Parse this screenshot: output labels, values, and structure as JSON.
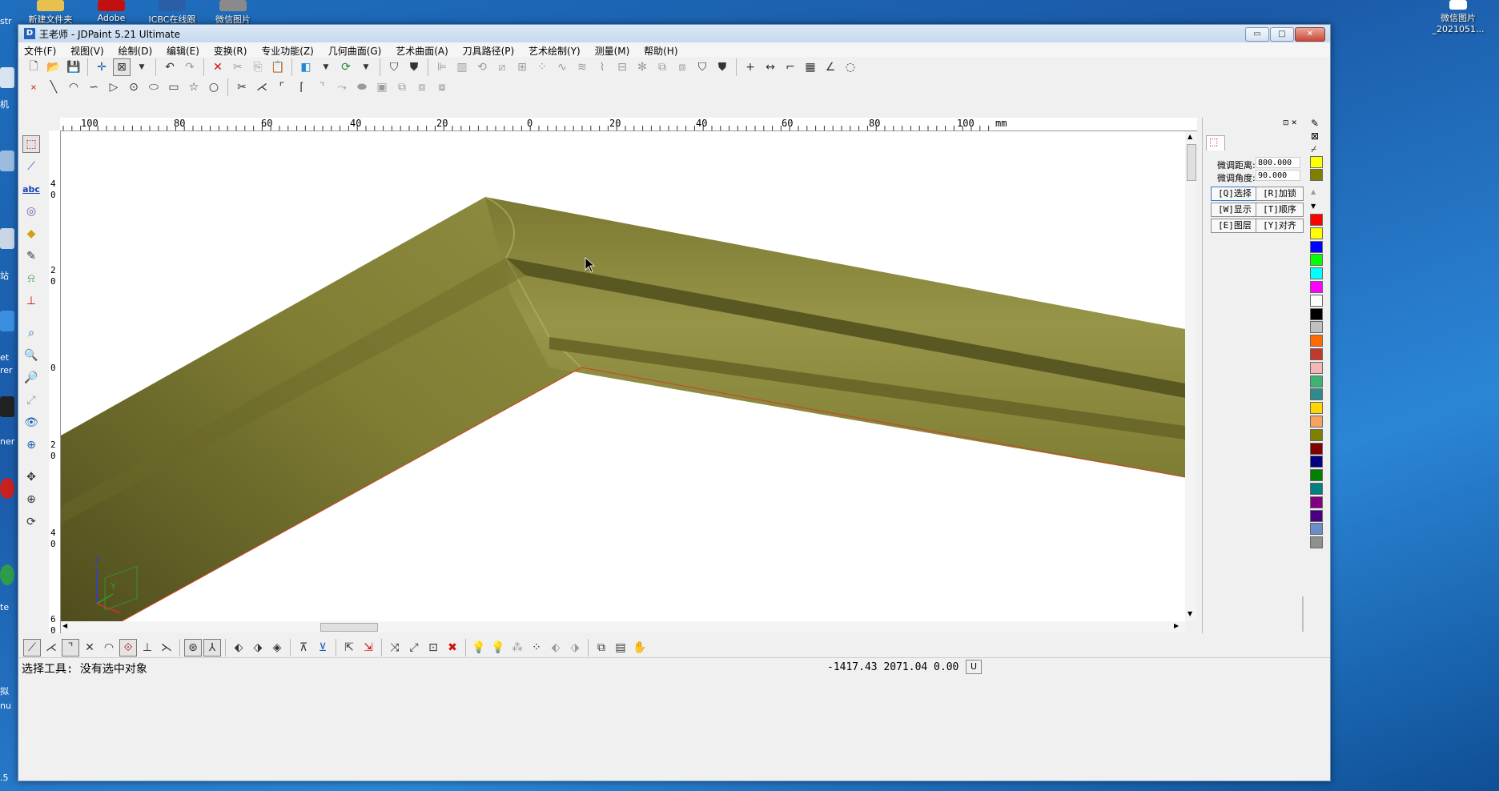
{
  "desktop": {
    "icons_top": [
      {
        "label": "新建文件夹",
        "color": "#e8c050"
      },
      {
        "label": "Adobe",
        "color": "#c01010"
      },
      {
        "label": "ICBC在线跟",
        "color": "#2a5fa8"
      },
      {
        "label": "微信图片",
        "color": "#8a8a8a"
      }
    ],
    "right_icon": {
      "label_line1": "微信图片",
      "label_line2": "_2021051..."
    },
    "left_fragments": [
      "str",
      "机",
      "站",
      "et",
      "rer",
      "ner",
      "te",
      "拟",
      "nu",
      ".5"
    ]
  },
  "window": {
    "title": "王老师 - JDPaint 5.21 Ultimate",
    "app_icon_letter": "D",
    "buttons": {
      "minimize": "▭",
      "maximize": "□",
      "close": "✕"
    }
  },
  "menu": [
    "文件(F)",
    "视图(V)",
    "绘制(D)",
    "编辑(E)",
    "变换(R)",
    "专业功能(Z)",
    "几何曲面(G)",
    "艺术曲面(A)",
    "刀具路径(P)",
    "艺术绘制(Y)",
    "测量(M)",
    "帮助(H)"
  ],
  "ruler": {
    "h_labels": [
      "100",
      "80",
      "60",
      "40",
      "20",
      "0",
      "20",
      "40",
      "60",
      "80",
      "100",
      "mm"
    ],
    "v_labels": [
      "4",
      "0",
      "2",
      "0",
      "0",
      "2",
      "0",
      "4",
      "0",
      "6",
      "0"
    ]
  },
  "panel": {
    "fine_distance_label": "微调距离:",
    "fine_distance_value": "800.000",
    "fine_angle_label": "微调角度:",
    "fine_angle_value": "90.000",
    "buttons": [
      "[Q]选择",
      "[R]加锁",
      "[W]显示",
      "[T]顺序",
      "[E]图层",
      "[Y]对齐"
    ]
  },
  "palette": [
    "#ffff00",
    "#808000",
    "#ff0000",
    "#ffff00",
    "#0000ff",
    "#00ff00",
    "#00ffff",
    "#ff00ff",
    "#ffffff",
    "#000000",
    "#c0c0c0",
    "#ff6a00",
    "#c0392b",
    "#f4b6b6",
    "#3cb371",
    "#2e8b8b",
    "#ffd700",
    "#f4a460",
    "#808000",
    "#800000",
    "#000080",
    "#008000",
    "#008080",
    "#800080",
    "#4b0082",
    "#6a8fc8",
    "#909090"
  ],
  "model": {
    "fill": "#7f7d33",
    "light": "#979548",
    "dark": "#4f4d1d",
    "edge": "#d04020"
  },
  "axis": {
    "z": "Z",
    "y": "Y"
  },
  "status": {
    "message": "选择工具: 没有选中对象",
    "coords": "-1417.43  2071.04  0.00",
    "unit": "U"
  }
}
